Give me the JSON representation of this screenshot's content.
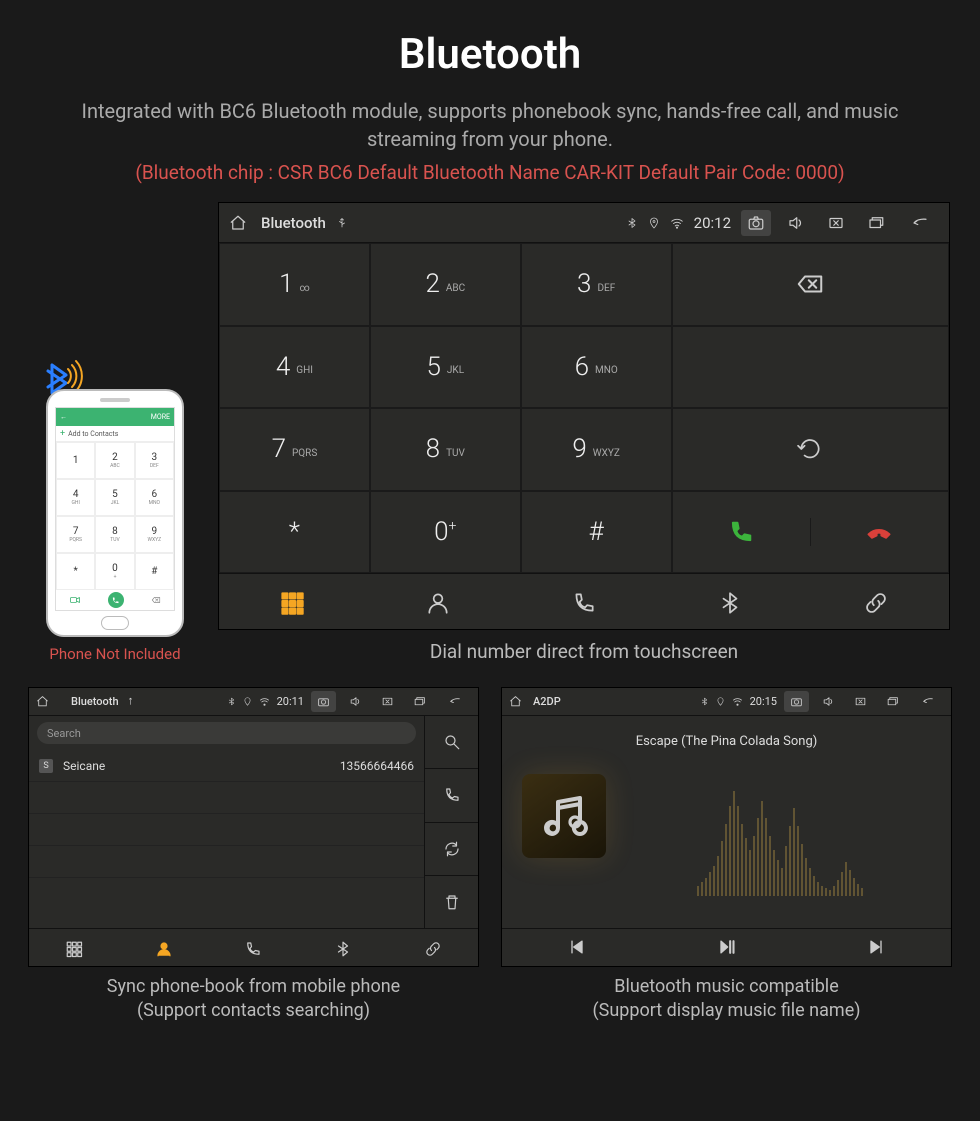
{
  "title": "Bluetooth",
  "description": "Integrated with BC6 Bluetooth module, supports phonebook sync, hands-free call, and music streaming from your phone.",
  "specs": "(Bluetooth chip : CSR BC6    Default Bluetooth Name CAR-KIT    Default Pair Code: 0000)",
  "phone_note": "Phone Not Included",
  "phone_mock": {
    "topbar_left": "←",
    "add_contacts": "Add to Contacts",
    "more": "MORE",
    "keys": [
      {
        "n": "1",
        "l": ""
      },
      {
        "n": "2",
        "l": "ABC"
      },
      {
        "n": "3",
        "l": "DEF"
      },
      {
        "n": "4",
        "l": "GHI"
      },
      {
        "n": "5",
        "l": "JKL"
      },
      {
        "n": "6",
        "l": "MNO"
      },
      {
        "n": "7",
        "l": "PQRS"
      },
      {
        "n": "8",
        "l": "TUV"
      },
      {
        "n": "9",
        "l": "WXYZ"
      },
      {
        "n": "*",
        "l": ""
      },
      {
        "n": "0",
        "l": "+"
      },
      {
        "n": "#",
        "l": ""
      }
    ]
  },
  "main": {
    "statusbar": {
      "title": "Bluetooth",
      "time": "20:12"
    },
    "keys": [
      {
        "n": "1",
        "l": "∞"
      },
      {
        "n": "2",
        "l": "ABC"
      },
      {
        "n": "3",
        "l": "DEF"
      },
      {
        "n": "4",
        "l": "GHI"
      },
      {
        "n": "5",
        "l": "JKL"
      },
      {
        "n": "6",
        "l": "MNO"
      },
      {
        "n": "7",
        "l": "PQRS"
      },
      {
        "n": "8",
        "l": "TUV"
      },
      {
        "n": "9",
        "l": "WXYZ"
      },
      {
        "n": "*",
        "l": ""
      },
      {
        "n": "0",
        "l": "+"
      },
      {
        "n": "#",
        "l": ""
      }
    ],
    "caption": "Dial number direct from touchscreen"
  },
  "phonebook": {
    "statusbar": {
      "title": "Bluetooth",
      "time": "20:11"
    },
    "search_placeholder": "Search",
    "contact_letter": "S",
    "contact_name": "Seicane",
    "contact_number": "13566664466",
    "caption_l1": "Sync phone-book from mobile phone",
    "caption_l2": "(Support contacts searching)"
  },
  "music": {
    "statusbar": {
      "title": "A2DP",
      "time": "20:15"
    },
    "song": "Escape (The Pina Colada Song)",
    "caption_l1": "Bluetooth music compatible",
    "caption_l2": "(Support display music file name)"
  }
}
